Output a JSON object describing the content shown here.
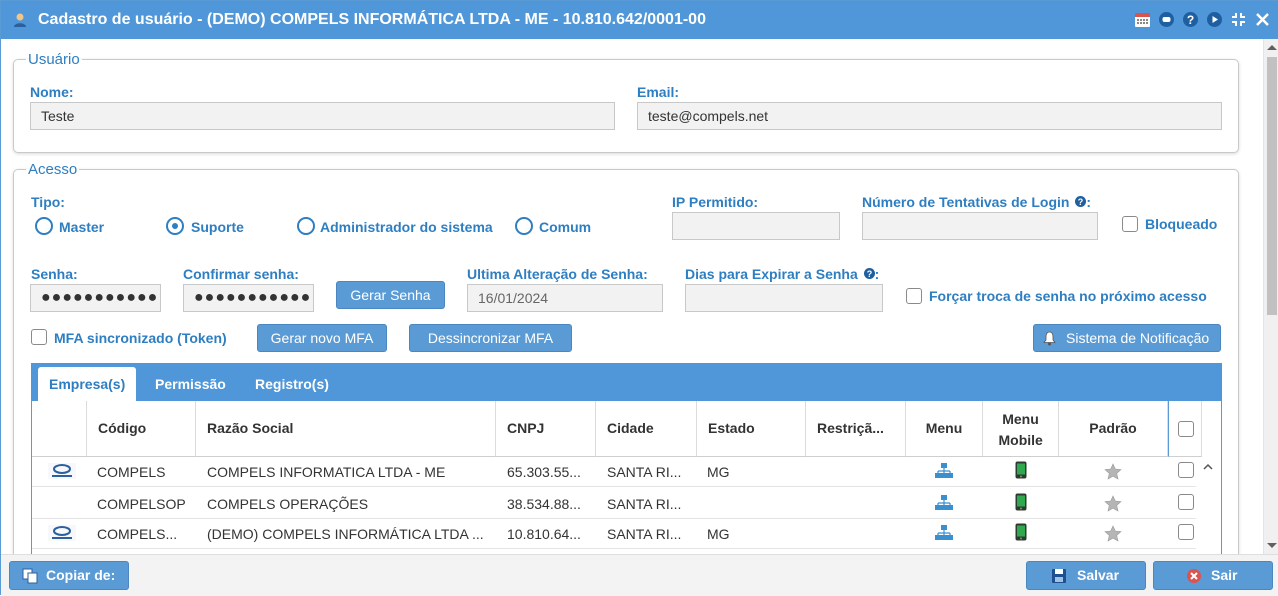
{
  "window": {
    "title": "Cadastro de usuário - (DEMO) COMPELS INFORMÁTICA LTDA - ME - 10.810.642/0001-00",
    "title_icon": "user-icon",
    "buttons": [
      "calendar-icon",
      "chat-icon",
      "help-icon",
      "play-icon",
      "collapse-icon",
      "close-icon"
    ]
  },
  "colors": {
    "accent": "#4f97d8",
    "label": "#2e7ec2",
    "button": "#5b9bd5",
    "danger": "#d9534f"
  },
  "usuario": {
    "legend": "Usuário",
    "nome_label": "Nome:",
    "nome_value": "Teste",
    "email_label": "Email:",
    "email_value": "teste@compels.net"
  },
  "acesso": {
    "legend": "Acesso",
    "tipo_label": "Tipo:",
    "tipos": [
      {
        "label": "Master",
        "selected": false
      },
      {
        "label": "Suporte",
        "selected": true
      },
      {
        "label": "Administrador do sistema",
        "selected": false
      },
      {
        "label": "Comum",
        "selected": false
      }
    ],
    "ip_label": "IP Permitido:",
    "ip_value": "",
    "tentativas_label": "Número de Tentativas de Login",
    "tentativas_value": "",
    "bloqueado_label": "Bloqueado",
    "senha_label": "Senha:",
    "senha_value": "●●●●●●●●●●●",
    "confirmar_label": "Confirmar senha:",
    "confirmar_value": "●●●●●●●●●●●",
    "gerar_senha": "Gerar Senha",
    "ultima_alteracao_label": "Ultima Alteração de Senha:",
    "ultima_alteracao_value": "16/01/2024",
    "dias_expirar_label": "Dias para Expirar a Senha",
    "dias_expirar_value": "",
    "forcar_troca_label": "Forçar troca de senha no próximo acesso",
    "mfa_label": "MFA sincronizado (Token)",
    "gerar_mfa": "Gerar novo MFA",
    "dessincronizar_mfa": "Dessincronizar MFA",
    "sistema_notificacao": "Sistema de Notificação"
  },
  "tabs": [
    "Empresa(s)",
    "Permissão",
    "Registro(s)"
  ],
  "grid": {
    "columns": [
      "",
      "Código",
      "Razão Social",
      "CNPJ",
      "Cidade",
      "Estado",
      "Restriçã...",
      "Menu",
      "Menu Mobile",
      "Padrão",
      ""
    ],
    "rows": [
      {
        "codigo": "COMPELS",
        "razao": "COMPELS INFORMATICA LTDA - ME",
        "cnpj": "65.303.55...",
        "cidade": "SANTA RI...",
        "estado": "MG",
        "has_logo": true
      },
      {
        "codigo": "COMPELSOP",
        "razao": "COMPELS OPERAÇÕES",
        "cnpj": "38.534.88...",
        "cidade": "SANTA RI...",
        "estado": "",
        "has_logo": false
      },
      {
        "codigo": "COMPELS...",
        "razao": "(DEMO) COMPELS INFORMÁTICA LTDA ...",
        "cnpj": "10.810.64...",
        "cidade": "SANTA RI...",
        "estado": "MG",
        "has_logo": true
      }
    ]
  },
  "footer": {
    "copiar": "Copiar de:",
    "salvar": "Salvar",
    "sair": "Sair"
  }
}
